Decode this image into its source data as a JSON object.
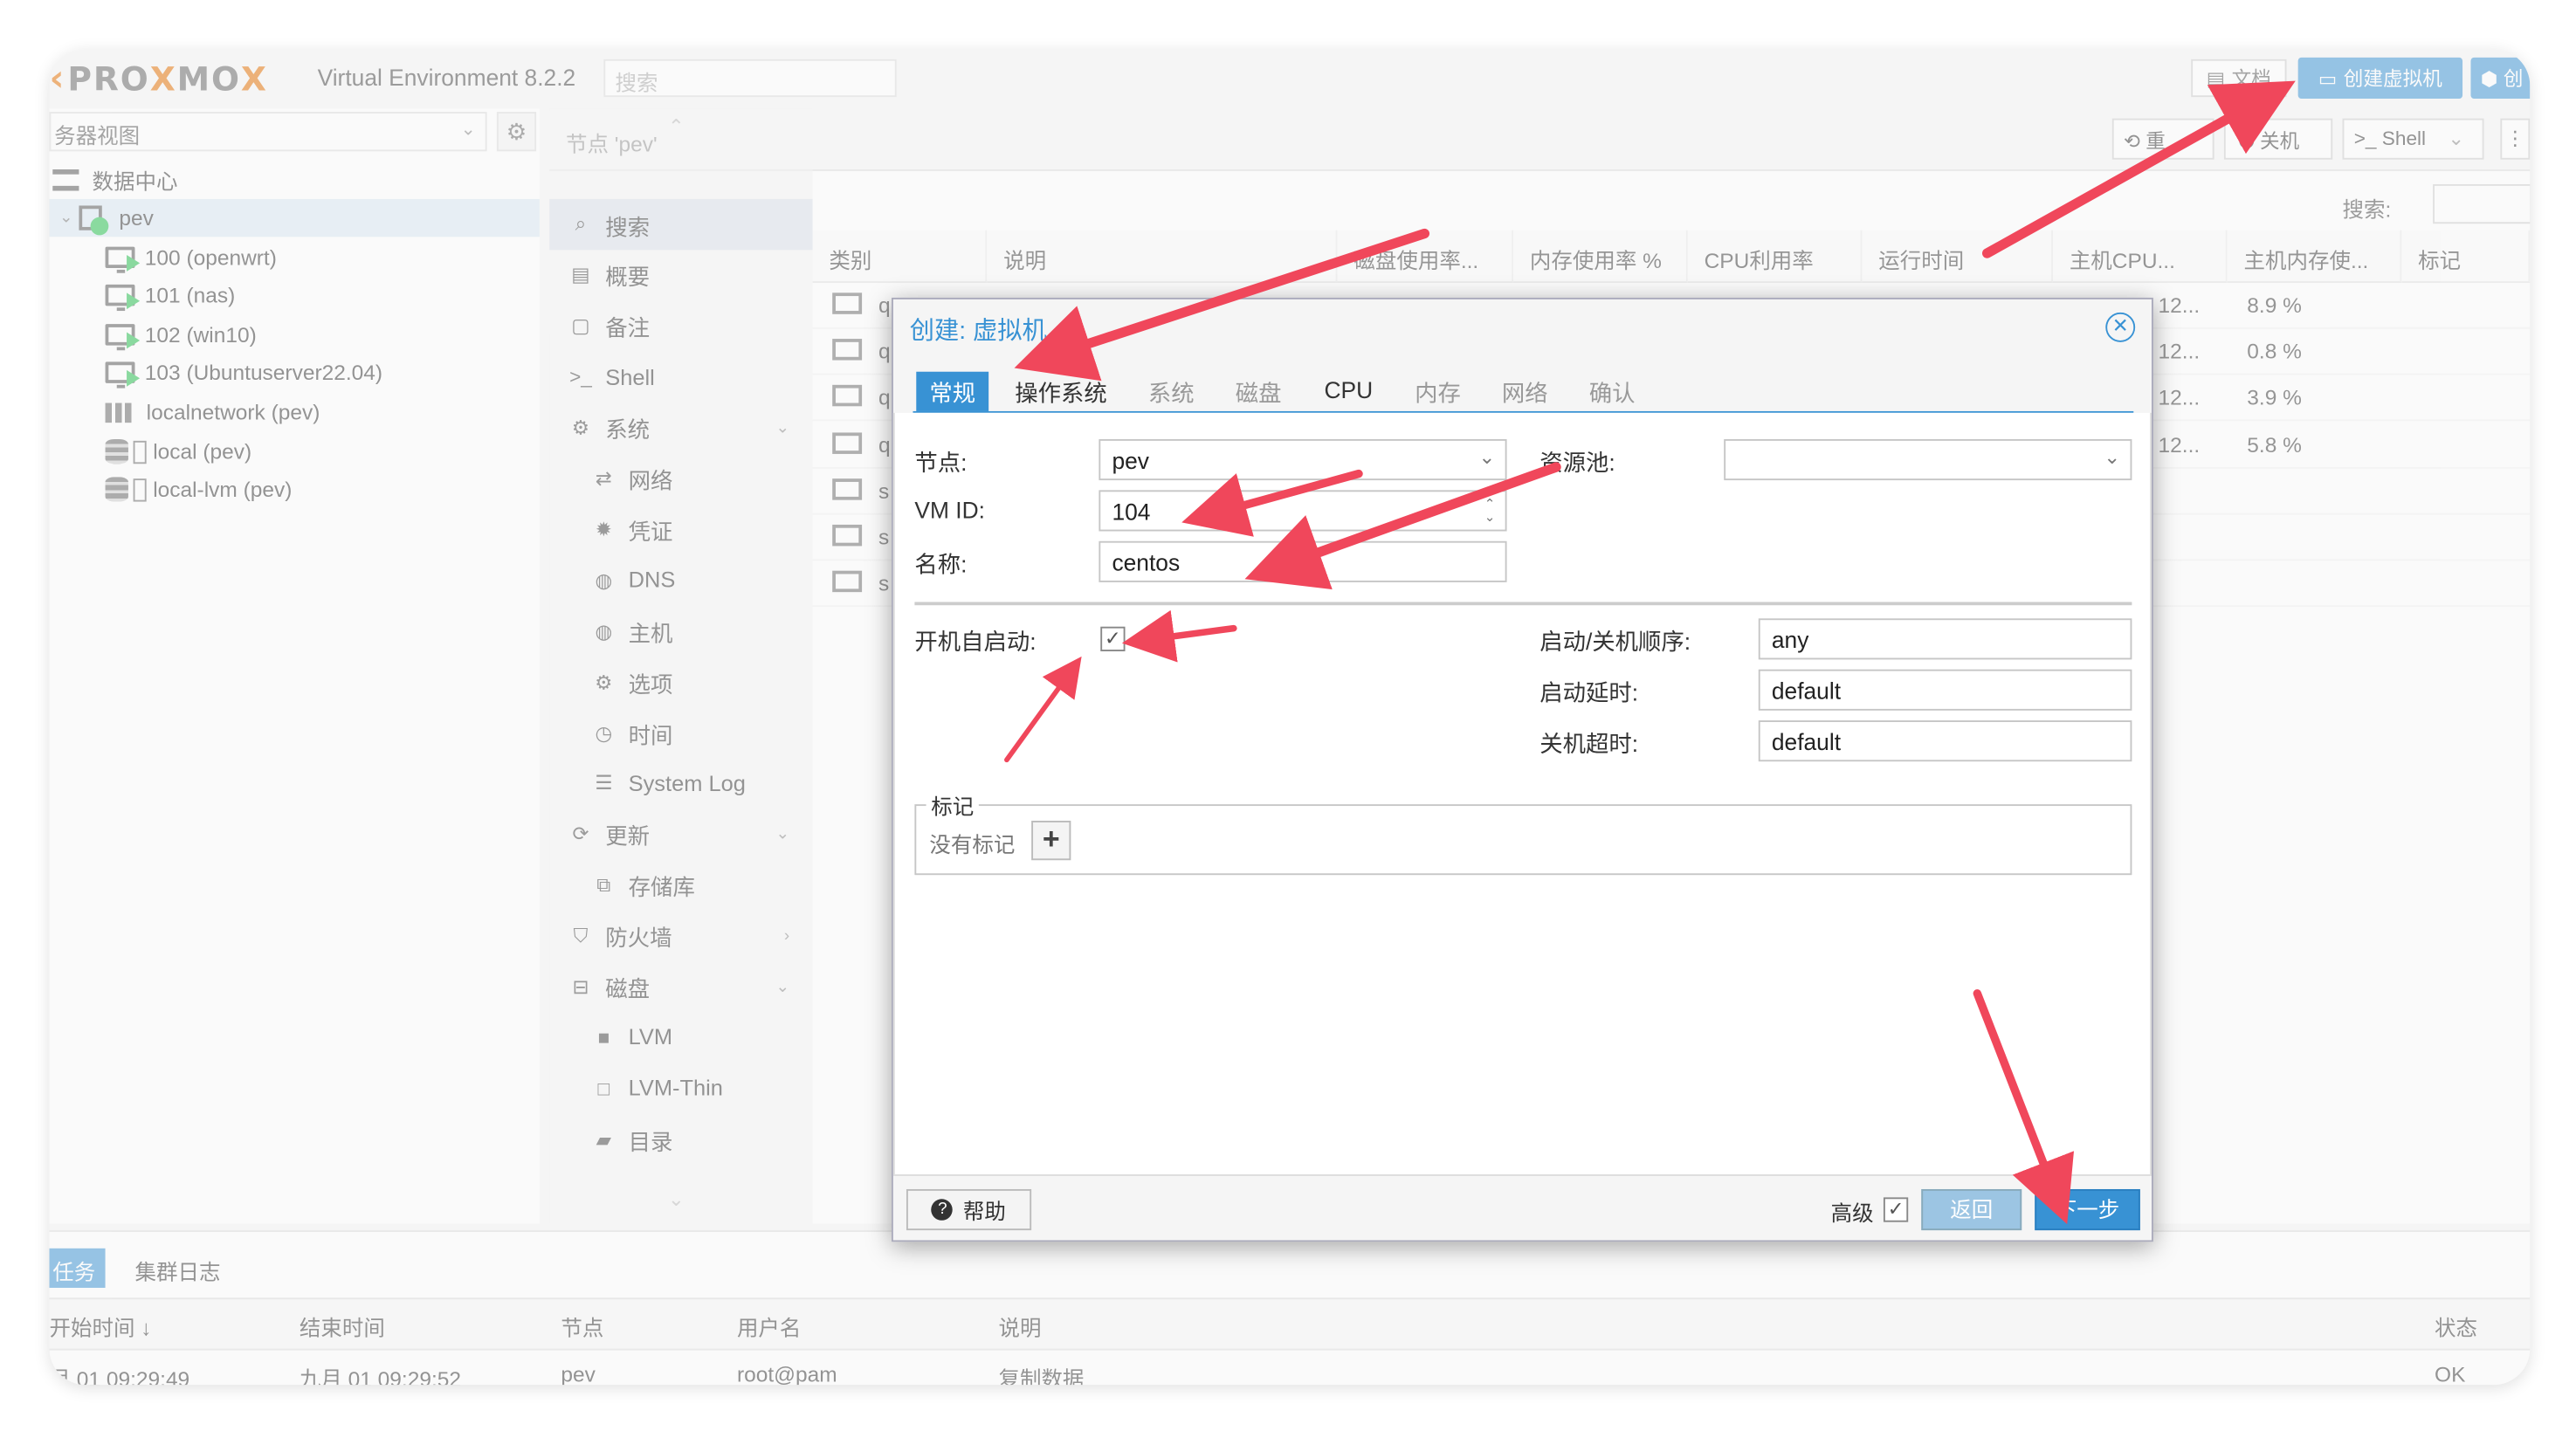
{
  "header": {
    "logo_left": "PRO",
    "logo_x1": "X",
    "logo_mid": "MO",
    "logo_x2": "X",
    "version": "Virtual Environment 8.2.2",
    "search_placeholder": "搜索",
    "doc_button": "文档",
    "create_vm_button": "创建虚拟机",
    "create_ct_button": "创"
  },
  "tree": {
    "view_select": "务器视图",
    "items": [
      {
        "label": "数据中心",
        "icon": "datacenter-icon"
      },
      {
        "label": "pev",
        "icon": "node-icon"
      },
      {
        "label": "100 (openwrt)",
        "icon": "vm-running-icon"
      },
      {
        "label": "101 (nas)",
        "icon": "vm-running-icon"
      },
      {
        "label": "102 (win10)",
        "icon": "vm-running-icon"
      },
      {
        "label": "103 (Ubuntuserver22.04)",
        "icon": "vm-running-icon"
      },
      {
        "label": "localnetwork (pev)",
        "icon": "network-grid-icon"
      },
      {
        "label": "local (pev)",
        "icon": "storage-icon"
      },
      {
        "label": "local-lvm (pev)",
        "icon": "storage-icon"
      }
    ]
  },
  "content_header": {
    "title": "节点 'pev'",
    "restart": "重",
    "shutdown": "关机",
    "shell": "Shell"
  },
  "nav": {
    "items": [
      {
        "label": "搜索",
        "icon": "search-icon"
      },
      {
        "label": "概要",
        "icon": "summary-icon"
      },
      {
        "label": "备注",
        "icon": "notes-icon"
      },
      {
        "label": "Shell",
        "icon": "terminal-icon"
      },
      {
        "label": "系统",
        "icon": "system-icon"
      },
      {
        "label": "网络",
        "icon": "network-icon"
      },
      {
        "label": "凭证",
        "icon": "certificate-icon"
      },
      {
        "label": "DNS",
        "icon": "globe-icon"
      },
      {
        "label": "主机",
        "icon": "globe-icon"
      },
      {
        "label": "选项",
        "icon": "gear-icon"
      },
      {
        "label": "时间",
        "icon": "clock-icon"
      },
      {
        "label": "System Log",
        "icon": "list-icon"
      },
      {
        "label": "更新",
        "icon": "refresh-icon"
      },
      {
        "label": "存储库",
        "icon": "repository-icon"
      },
      {
        "label": "防火墙",
        "icon": "shield-icon"
      },
      {
        "label": "磁盘",
        "icon": "disk-icon"
      },
      {
        "label": "LVM",
        "icon": "square-icon"
      },
      {
        "label": "LVM-Thin",
        "icon": "square-outline-icon"
      },
      {
        "label": "目录",
        "icon": "folder-icon"
      }
    ]
  },
  "grid": {
    "search_label": "搜索:",
    "columns": [
      "类别",
      "说明",
      "磁盘使用率...",
      "内存使用率 %",
      "CPU利用率",
      "运行时间",
      "主机CPU...",
      "主机内存使...",
      "标记"
    ],
    "row_prefix": [
      "q",
      "q",
      "q",
      "q",
      "s",
      "s",
      "s"
    ],
    "host_cpu": [
      "12...",
      "12...",
      "12...",
      "12..."
    ],
    "host_mem": [
      "8.9 %",
      "0.8 %",
      "3.9 %",
      "5.8 %"
    ]
  },
  "dialog": {
    "title": "创建: 虚拟机",
    "tabs": [
      "常规",
      "操作系统",
      "系统",
      "磁盘",
      "CPU",
      "内存",
      "网络",
      "确认"
    ],
    "node_label": "节点:",
    "node_value": "pev",
    "pool_label": "资源池:",
    "pool_value": "",
    "vmid_label": "VM ID:",
    "vmid_value": "104",
    "name_label": "名称:",
    "name_value": "centos",
    "onboot_label": "开机自启动:",
    "onboot_checked": true,
    "order_label": "启动/关机顺序:",
    "order_value": "any",
    "startup_delay_label": "启动延时:",
    "startup_delay_value": "default",
    "shutdown_timeout_label": "关机超时:",
    "shutdown_timeout_value": "default",
    "tags_legend": "标记",
    "tags_empty": "没有标记",
    "help_button": "帮助",
    "advanced_label": "高级",
    "advanced_checked": true,
    "back_button": "返回",
    "next_button": "下一步"
  },
  "bottom": {
    "tabs": [
      "任务",
      "集群日志"
    ],
    "columns": [
      "开始时间 ↓",
      "结束时间",
      "节点",
      "用户名",
      "说明",
      "状态"
    ],
    "row": {
      "start": "月 01 09:29:49",
      "end": "九月 01 09:29:52",
      "node": "pev",
      "user": "root@pam",
      "desc": "复制数据",
      "status": "OK"
    }
  },
  "colors": {
    "accent": "#3892d4",
    "logo_orange": "#e57000",
    "annotation_arrow": "#f0475b",
    "vm_running": "#21bf4b"
  }
}
